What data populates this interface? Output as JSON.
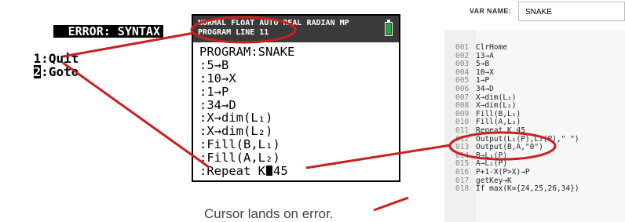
{
  "error_screen": {
    "title": "ERROR: SYNTAX",
    "menu": [
      {
        "num": "1",
        "label": "Quit"
      },
      {
        "num": "2",
        "label": "Goto"
      }
    ]
  },
  "calculator": {
    "status_line1": "NORMAL FLOAT AUTO REAL RADIAN MP",
    "status_line2": "PROGRAM LINE 11",
    "program_lines": [
      "PROGRAM:SNAKE",
      ":5→B",
      ":10→X",
      ":1→P",
      ":34→D",
      ":X→dim(L₁)",
      ":X→dim(L₂)",
      ":Fill(B,L₁)",
      ":Fill(A,L₂)"
    ],
    "repeat_line_before": ":Repeat K",
    "repeat_line_after": "45"
  },
  "caption": "Cursor lands on error.",
  "editor": {
    "var_name_label": "VAR NAME:",
    "var_name_value": "SNAKE",
    "code_lines": [
      {
        "n": "001",
        "t": "ClrHome"
      },
      {
        "n": "002",
        "t": "13→A"
      },
      {
        "n": "003",
        "t": "5→B"
      },
      {
        "n": "004",
        "t": "10→X"
      },
      {
        "n": "005",
        "t": "1→P"
      },
      {
        "n": "006",
        "t": "34→D"
      },
      {
        "n": "007",
        "t": "X→dim(L₁)"
      },
      {
        "n": "008",
        "t": "X→dim(L₂)"
      },
      {
        "n": "009",
        "t": "Fill(B,L₁)"
      },
      {
        "n": "010",
        "t": "Fill(A,L₂)"
      },
      {
        "n": "011",
        "t": "Repeat K,45"
      },
      {
        "n": "012",
        "t": "Output(L₁(P),L₂(P),\" \")"
      },
      {
        "n": "013",
        "t": "Output(B,A,\"0\")"
      },
      {
        "n": "014",
        "t": "B→L₁(P)"
      },
      {
        "n": "015",
        "t": "A→L₂(P)"
      },
      {
        "n": "016",
        "t": "P+1-X(P>X)→P"
      },
      {
        "n": "017",
        "t": "getKey→K"
      },
      {
        "n": "018",
        "t": "If max(K={24,25,26,34})"
      }
    ]
  },
  "colors": {
    "annotation": "#cc1f1f",
    "battery": "#2ea043",
    "status_bar": "#3a3a3a"
  }
}
